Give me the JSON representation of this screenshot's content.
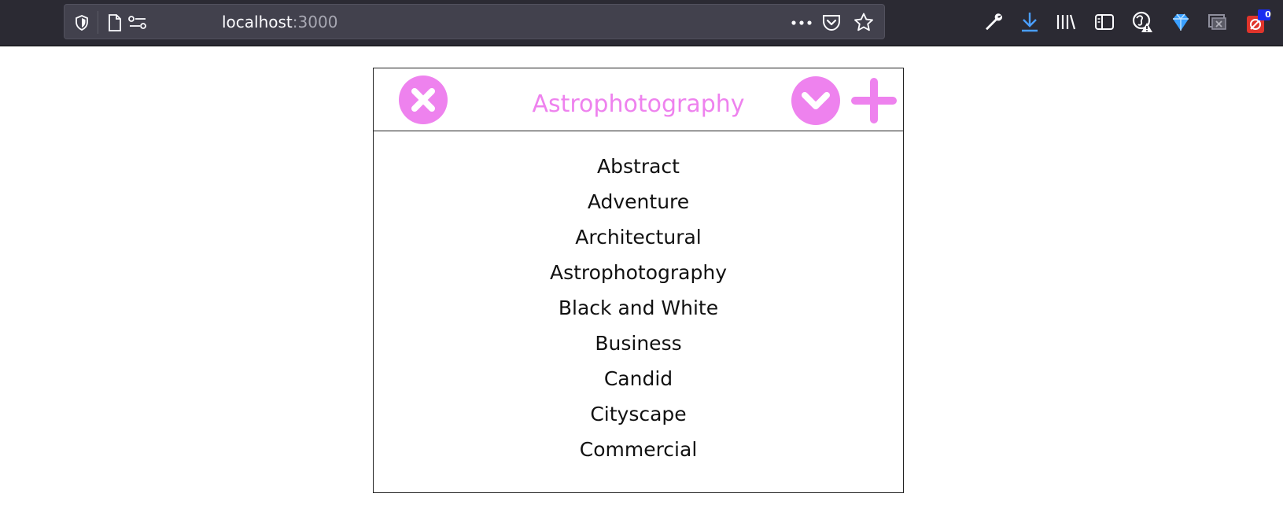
{
  "browser": {
    "url_host": "localhost",
    "url_port": ":3000",
    "download_badge_count": "0"
  },
  "panel": {
    "title": "Astrophotography",
    "accent_color": "#ee82ee",
    "items": [
      {
        "label": "Abstract"
      },
      {
        "label": "Adventure"
      },
      {
        "label": "Architectural"
      },
      {
        "label": "Astrophotography"
      },
      {
        "label": "Black and White"
      },
      {
        "label": "Business"
      },
      {
        "label": "Candid"
      },
      {
        "label": "Cityscape"
      },
      {
        "label": "Commercial"
      }
    ]
  }
}
